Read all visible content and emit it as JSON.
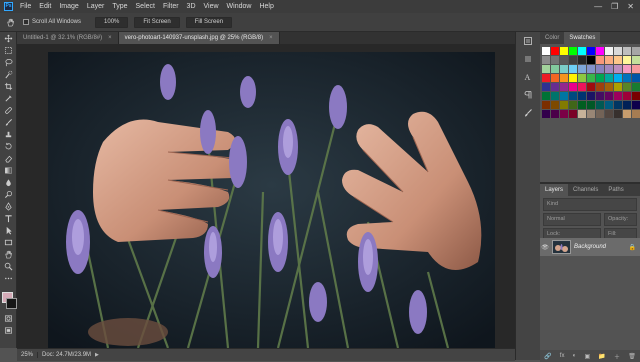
{
  "menu": {
    "logo": "Ps",
    "items": [
      "File",
      "Edit",
      "Image",
      "Layer",
      "Type",
      "Select",
      "Filter",
      "3D",
      "View",
      "Window",
      "Help"
    ],
    "window_controls": [
      "—",
      "❐",
      "✕"
    ]
  },
  "options": {
    "scroll_all_windows": "Scroll All Windows",
    "btn_100": "100%",
    "btn_fit_screen": "Fit Screen",
    "btn_fill_screen": "Fill Screen"
  },
  "tabs": [
    {
      "label": "Untitled-1 @ 32.1% (RGB/8#)",
      "close": "×"
    },
    {
      "label": "vero-photoart-140937-unsplash.jpg @ 25% (RGB/8)",
      "close": "×"
    }
  ],
  "status": {
    "zoom": "25%",
    "doc": "Doc: 24.7M/23.9M",
    "arrow": "▶"
  },
  "color_panel": {
    "tabs": [
      "Color",
      "Swatches"
    ],
    "swatches": [
      "#ffffff",
      "#ff0000",
      "#ffff00",
      "#00ff00",
      "#00ffff",
      "#0000ff",
      "#ff00ff",
      "#f2f2f2",
      "#d9d9d9",
      "#bfbfbf",
      "#a6a6a6",
      "#8c8c8c",
      "#737373",
      "#595959",
      "#404040",
      "#262626",
      "#000000",
      "#f7977a",
      "#f9ad81",
      "#fdc68a",
      "#fff79a",
      "#c4df9b",
      "#a3d39c",
      "#82ca9d",
      "#7bcdc8",
      "#6ecff6",
      "#7ea7d8",
      "#8493ca",
      "#8882be",
      "#a187be",
      "#bc8dbf",
      "#f49ac2",
      "#f6989d",
      "#ed1c24",
      "#f26522",
      "#f7941d",
      "#fff200",
      "#8dc73f",
      "#39b54a",
      "#00a651",
      "#00a99d",
      "#00aeef",
      "#0072bc",
      "#0054a6",
      "#2e3192",
      "#662d91",
      "#92278f",
      "#ec008c",
      "#ed145b",
      "#9e0b0f",
      "#a0410d",
      "#a36209",
      "#aba000",
      "#598527",
      "#197b30",
      "#007236",
      "#00746b",
      "#0076a3",
      "#004a80",
      "#003471",
      "#1b1464",
      "#440e62",
      "#630460",
      "#9e005d",
      "#9e0039",
      "#790000",
      "#7b2e00",
      "#7d4900",
      "#827b00",
      "#406618",
      "#005e20",
      "#005826",
      "#005952",
      "#005b7f",
      "#003663",
      "#002157",
      "#0d004c",
      "#32004b",
      "#4b0049",
      "#7b0046",
      "#7a0026",
      "#c7b299",
      "#998675",
      "#736357",
      "#534741",
      "#37302d",
      "#c69c6d",
      "#a67c52"
    ]
  },
  "layers_panel": {
    "tabs": [
      "Layers",
      "Channels",
      "Paths"
    ],
    "kind": "Kind",
    "blend_mode": "Normal",
    "opacity": "Opacity:",
    "lock": "Lock:",
    "fill": "Fill:",
    "layer_name": "Background",
    "footer_icons": [
      "🔗",
      "fx",
      "◐",
      "▣",
      "📁",
      "＋",
      "🗑"
    ]
  }
}
